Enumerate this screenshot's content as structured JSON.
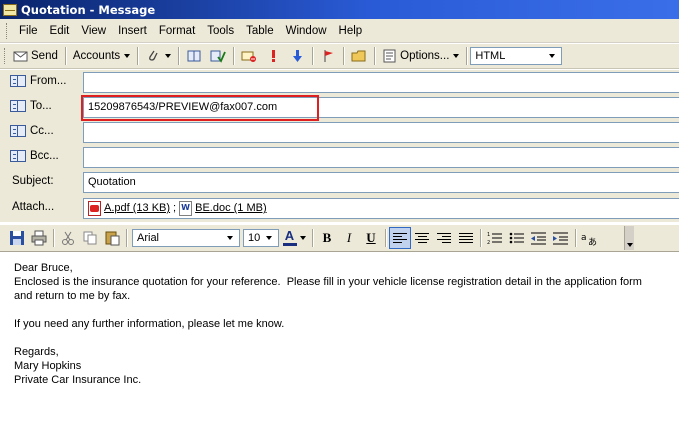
{
  "window": {
    "title": "Quotation - Message"
  },
  "menubar": {
    "items": [
      "File",
      "Edit",
      "View",
      "Insert",
      "Format",
      "Tools",
      "Table",
      "Window",
      "Help"
    ]
  },
  "toolbar": {
    "send_label": "Send",
    "accounts_label": "Accounts",
    "options_label": "Options...",
    "format_value": "HTML"
  },
  "header": {
    "from_label": "From...",
    "from_value": "",
    "to_label": "To...",
    "to_value": "15209876543/PREVIEW@fax007.com",
    "cc_label": "Cc...",
    "cc_value": "",
    "bcc_label": "Bcc...",
    "bcc_value": "",
    "subject_label": "Subject:",
    "subject_value": "Quotation",
    "attach_label": "Attach...",
    "attachments": [
      {
        "name": "A.pdf (13 KB)",
        "icon": "pdf-file-icon"
      },
      {
        "name": "BE.doc (1 MB)",
        "icon": "word-doc-icon"
      }
    ],
    "attach_separator": ";"
  },
  "format": {
    "font_name": "Arial",
    "font_size": "10",
    "bold": "B",
    "italic": "I",
    "underline": "U",
    "font_color_letter": "A"
  },
  "body": {
    "lines": [
      "Dear Bruce,",
      "Enclosed is the insurance quotation for your reference.  Please fill in your vehicle license registration detail in the application form",
      "and return to me by fax.",
      "",
      "If you need any further information, please let me know.",
      "",
      "Regards,",
      "Mary Hopkins",
      "Private Car Insurance Inc."
    ]
  },
  "colors": {
    "titlebar": "#0a246a",
    "chrome": "#ece9d8",
    "highlight": "#e02020"
  }
}
